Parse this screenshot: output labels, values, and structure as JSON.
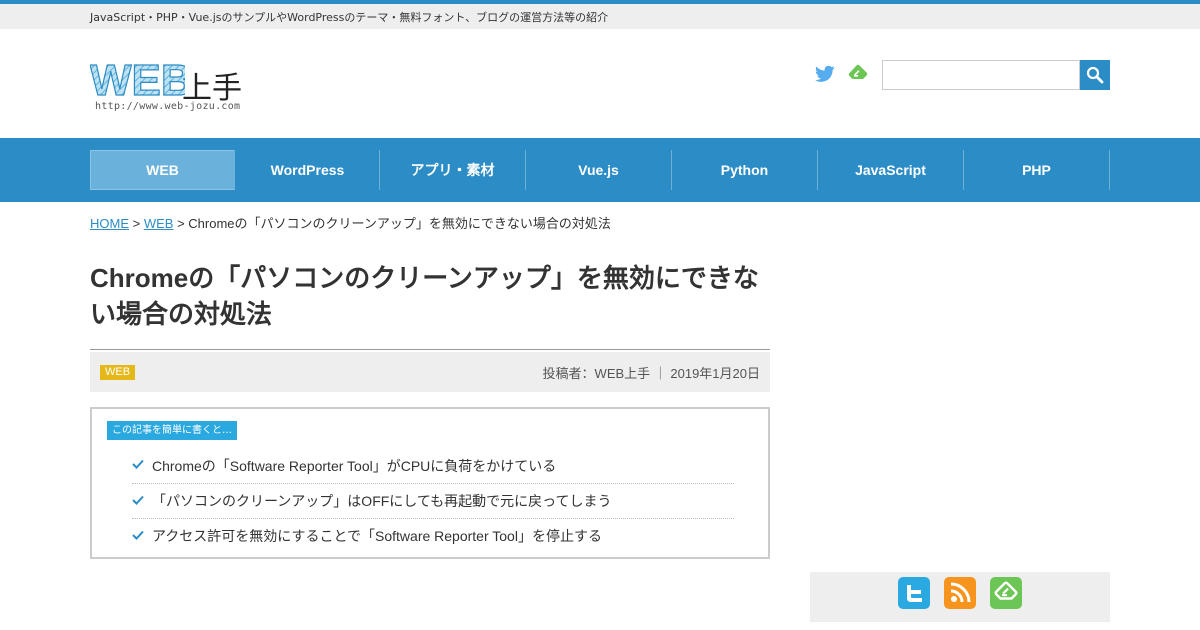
{
  "header": {
    "tagline": "JavaScript・PHP・Vue.jsのサンプルやWordPressのテーマ・無料フォント、ブログの運営方法等の紹介",
    "logo": {
      "mark": "WEB",
      "jp": "上手",
      "url": "http://www.web-jozu.com"
    },
    "social": [
      "twitter-icon",
      "feedly-icon"
    ],
    "search": {
      "value": "",
      "placeholder": ""
    },
    "accent_color": "#2c8cc5"
  },
  "nav": {
    "items": [
      {
        "label": "WEB",
        "active": true
      },
      {
        "label": "WordPress"
      },
      {
        "label": "アプリ・素材"
      },
      {
        "label": "Vue.js"
      },
      {
        "label": "Python"
      },
      {
        "label": "JavaScript"
      },
      {
        "label": "PHP"
      }
    ]
  },
  "breadcrumb": {
    "home": "HOME",
    "sep": " > ",
    "category": "WEB",
    "current": "Chromeの「パソコンのクリーンアップ」を無効にできない場合の対処法"
  },
  "post": {
    "title": "Chromeの「パソコンのクリーンアップ」を無効にできない場合の対処法",
    "category": "WEB",
    "meta": "投稿者：WEB上手 ｜ 2019年1月20日",
    "badge_color": "#e5b81a"
  },
  "summary": {
    "label": "この記事を簡単に書くと…",
    "items": [
      "Chromeの「Software Reporter Tool」がCPUに負荷をかけている",
      "「パソコンのクリーンアップ」はOFFにしても再起動で元に戻ってしまう",
      "アクセス許可を無効にすることで「Software Reporter Tool」を停止する"
    ]
  },
  "sidebar": {
    "icons": [
      "twitter-icon",
      "rss-icon",
      "feedly-icon"
    ]
  }
}
